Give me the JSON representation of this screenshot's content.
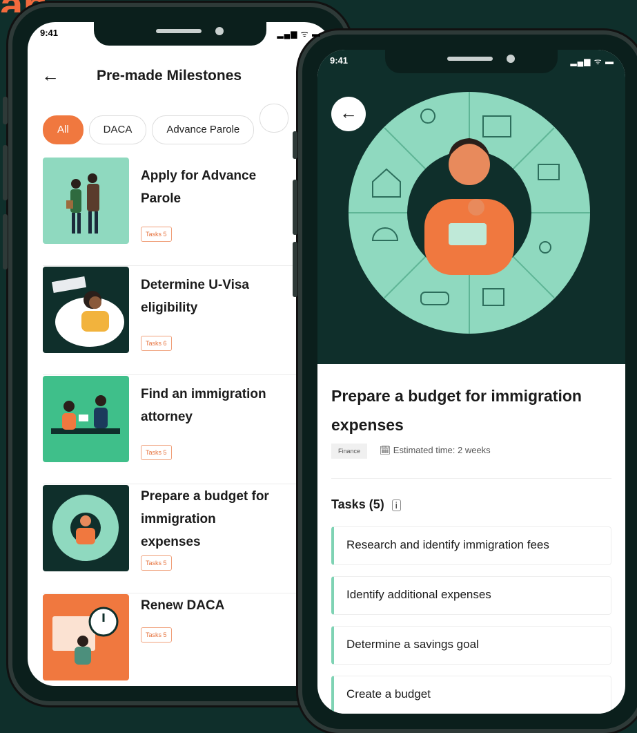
{
  "colors": {
    "background": "#0f2f2b",
    "accent": "#f0783f",
    "mint": "#8fd9bf"
  },
  "top_text": "ah",
  "status": {
    "time": "9:41",
    "icons": "signal wifi battery"
  },
  "left": {
    "title": "Pre-made Milestones",
    "chips": [
      "All",
      "DACA",
      "Advance Parole"
    ],
    "milestones": [
      {
        "title": "Apply for Advance Parole",
        "tasks": "Tasks 5"
      },
      {
        "title": "Determine U-Visa eligibility",
        "tasks": "Tasks 6"
      },
      {
        "title": "Find an immigration attorney",
        "tasks": "Tasks 5"
      },
      {
        "title": "Prepare a budget for immigration expenses",
        "tasks": "Tasks 5"
      },
      {
        "title": "Renew DACA",
        "tasks": "Tasks 5"
      }
    ]
  },
  "right": {
    "title": "Prepare a budget for immigration expenses",
    "category": "Finance",
    "estimate": "Estimated time: 2 weeks",
    "tasks_header": "Tasks (5)",
    "tasks": [
      "Research and identify immigration fees",
      "Identify additional expenses",
      "Determine a savings goal",
      "Create a budget"
    ]
  }
}
